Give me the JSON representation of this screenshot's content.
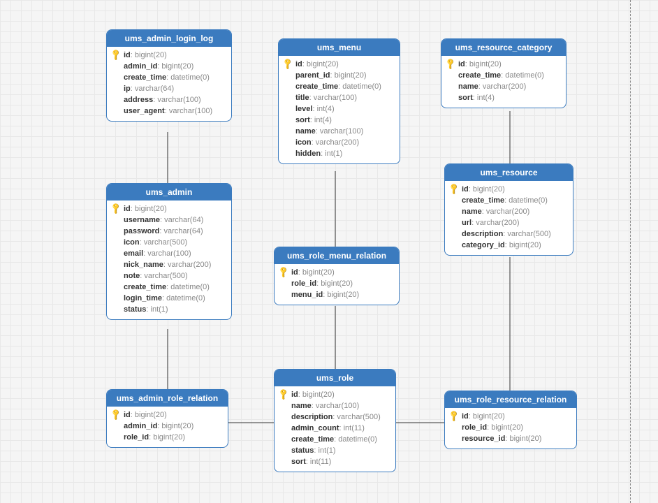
{
  "tables": {
    "ums_admin_login_log": {
      "title": "ums_admin_login_log",
      "cols": [
        {
          "pk": true,
          "name": "id",
          "type": "bigint(20)"
        },
        {
          "pk": false,
          "name": "admin_id",
          "type": "bigint(20)"
        },
        {
          "pk": false,
          "name": "create_time",
          "type": "datetime(0)"
        },
        {
          "pk": false,
          "name": "ip",
          "type": "varchar(64)"
        },
        {
          "pk": false,
          "name": "address",
          "type": "varchar(100)"
        },
        {
          "pk": false,
          "name": "user_agent",
          "type": "varchar(100)"
        }
      ]
    },
    "ums_admin": {
      "title": "ums_admin",
      "cols": [
        {
          "pk": true,
          "name": "id",
          "type": "bigint(20)"
        },
        {
          "pk": false,
          "name": "username",
          "type": "varchar(64)"
        },
        {
          "pk": false,
          "name": "password",
          "type": "varchar(64)"
        },
        {
          "pk": false,
          "name": "icon",
          "type": "varchar(500)"
        },
        {
          "pk": false,
          "name": "email",
          "type": "varchar(100)"
        },
        {
          "pk": false,
          "name": "nick_name",
          "type": "varchar(200)"
        },
        {
          "pk": false,
          "name": "note",
          "type": "varchar(500)"
        },
        {
          "pk": false,
          "name": "create_time",
          "type": "datetime(0)"
        },
        {
          "pk": false,
          "name": "login_time",
          "type": "datetime(0)"
        },
        {
          "pk": false,
          "name": "status",
          "type": "int(1)"
        }
      ]
    },
    "ums_admin_role_relation": {
      "title": "ums_admin_role_relation",
      "cols": [
        {
          "pk": true,
          "name": "id",
          "type": "bigint(20)"
        },
        {
          "pk": false,
          "name": "admin_id",
          "type": "bigint(20)"
        },
        {
          "pk": false,
          "name": "role_id",
          "type": "bigint(20)"
        }
      ]
    },
    "ums_menu": {
      "title": "ums_menu",
      "cols": [
        {
          "pk": true,
          "name": "id",
          "type": "bigint(20)"
        },
        {
          "pk": false,
          "name": "parent_id",
          "type": "bigint(20)"
        },
        {
          "pk": false,
          "name": "create_time",
          "type": "datetime(0)"
        },
        {
          "pk": false,
          "name": "title",
          "type": "varchar(100)"
        },
        {
          "pk": false,
          "name": "level",
          "type": "int(4)"
        },
        {
          "pk": false,
          "name": "sort",
          "type": "int(4)"
        },
        {
          "pk": false,
          "name": "name",
          "type": "varchar(100)"
        },
        {
          "pk": false,
          "name": "icon",
          "type": "varchar(200)"
        },
        {
          "pk": false,
          "name": "hidden",
          "type": "int(1)"
        }
      ]
    },
    "ums_role_menu_relation": {
      "title": "ums_role_menu_relation",
      "cols": [
        {
          "pk": true,
          "name": "id",
          "type": "bigint(20)"
        },
        {
          "pk": false,
          "name": "role_id",
          "type": "bigint(20)"
        },
        {
          "pk": false,
          "name": "menu_id",
          "type": "bigint(20)"
        }
      ]
    },
    "ums_role": {
      "title": "ums_role",
      "cols": [
        {
          "pk": true,
          "name": "id",
          "type": "bigint(20)"
        },
        {
          "pk": false,
          "name": "name",
          "type": "varchar(100)"
        },
        {
          "pk": false,
          "name": "description",
          "type": "varchar(500)"
        },
        {
          "pk": false,
          "name": "admin_count",
          "type": "int(11)"
        },
        {
          "pk": false,
          "name": "create_time",
          "type": "datetime(0)"
        },
        {
          "pk": false,
          "name": "status",
          "type": "int(1)"
        },
        {
          "pk": false,
          "name": "sort",
          "type": "int(11)"
        }
      ]
    },
    "ums_resource_category": {
      "title": "ums_resource_category",
      "cols": [
        {
          "pk": true,
          "name": "id",
          "type": "bigint(20)"
        },
        {
          "pk": false,
          "name": "create_time",
          "type": "datetime(0)"
        },
        {
          "pk": false,
          "name": "name",
          "type": "varchar(200)"
        },
        {
          "pk": false,
          "name": "sort",
          "type": "int(4)"
        }
      ]
    },
    "ums_resource": {
      "title": "ums_resource",
      "cols": [
        {
          "pk": true,
          "name": "id",
          "type": "bigint(20)"
        },
        {
          "pk": false,
          "name": "create_time",
          "type": "datetime(0)"
        },
        {
          "pk": false,
          "name": "name",
          "type": "varchar(200)"
        },
        {
          "pk": false,
          "name": "url",
          "type": "varchar(200)"
        },
        {
          "pk": false,
          "name": "description",
          "type": "varchar(500)"
        },
        {
          "pk": false,
          "name": "category_id",
          "type": "bigint(20)"
        }
      ]
    },
    "ums_role_resource_relation": {
      "title": "ums_role_resource_relation",
      "cols": [
        {
          "pk": true,
          "name": "id",
          "type": "bigint(20)"
        },
        {
          "pk": false,
          "name": "role_id",
          "type": "bigint(20)"
        },
        {
          "pk": false,
          "name": "resource_id",
          "type": "bigint(20)"
        }
      ]
    }
  },
  "connectors": [
    {
      "from": "ums_admin_login_log",
      "to": "ums_admin"
    },
    {
      "from": "ums_admin",
      "to": "ums_admin_role_relation"
    },
    {
      "from": "ums_admin_role_relation",
      "to": "ums_role"
    },
    {
      "from": "ums_menu",
      "to": "ums_role_menu_relation"
    },
    {
      "from": "ums_role_menu_relation",
      "to": "ums_role"
    },
    {
      "from": "ums_role",
      "to": "ums_role_resource_relation"
    },
    {
      "from": "ums_role_resource_relation",
      "to": "ums_resource"
    },
    {
      "from": "ums_resource",
      "to": "ums_resource_category"
    }
  ],
  "key_glyph": "🔑"
}
